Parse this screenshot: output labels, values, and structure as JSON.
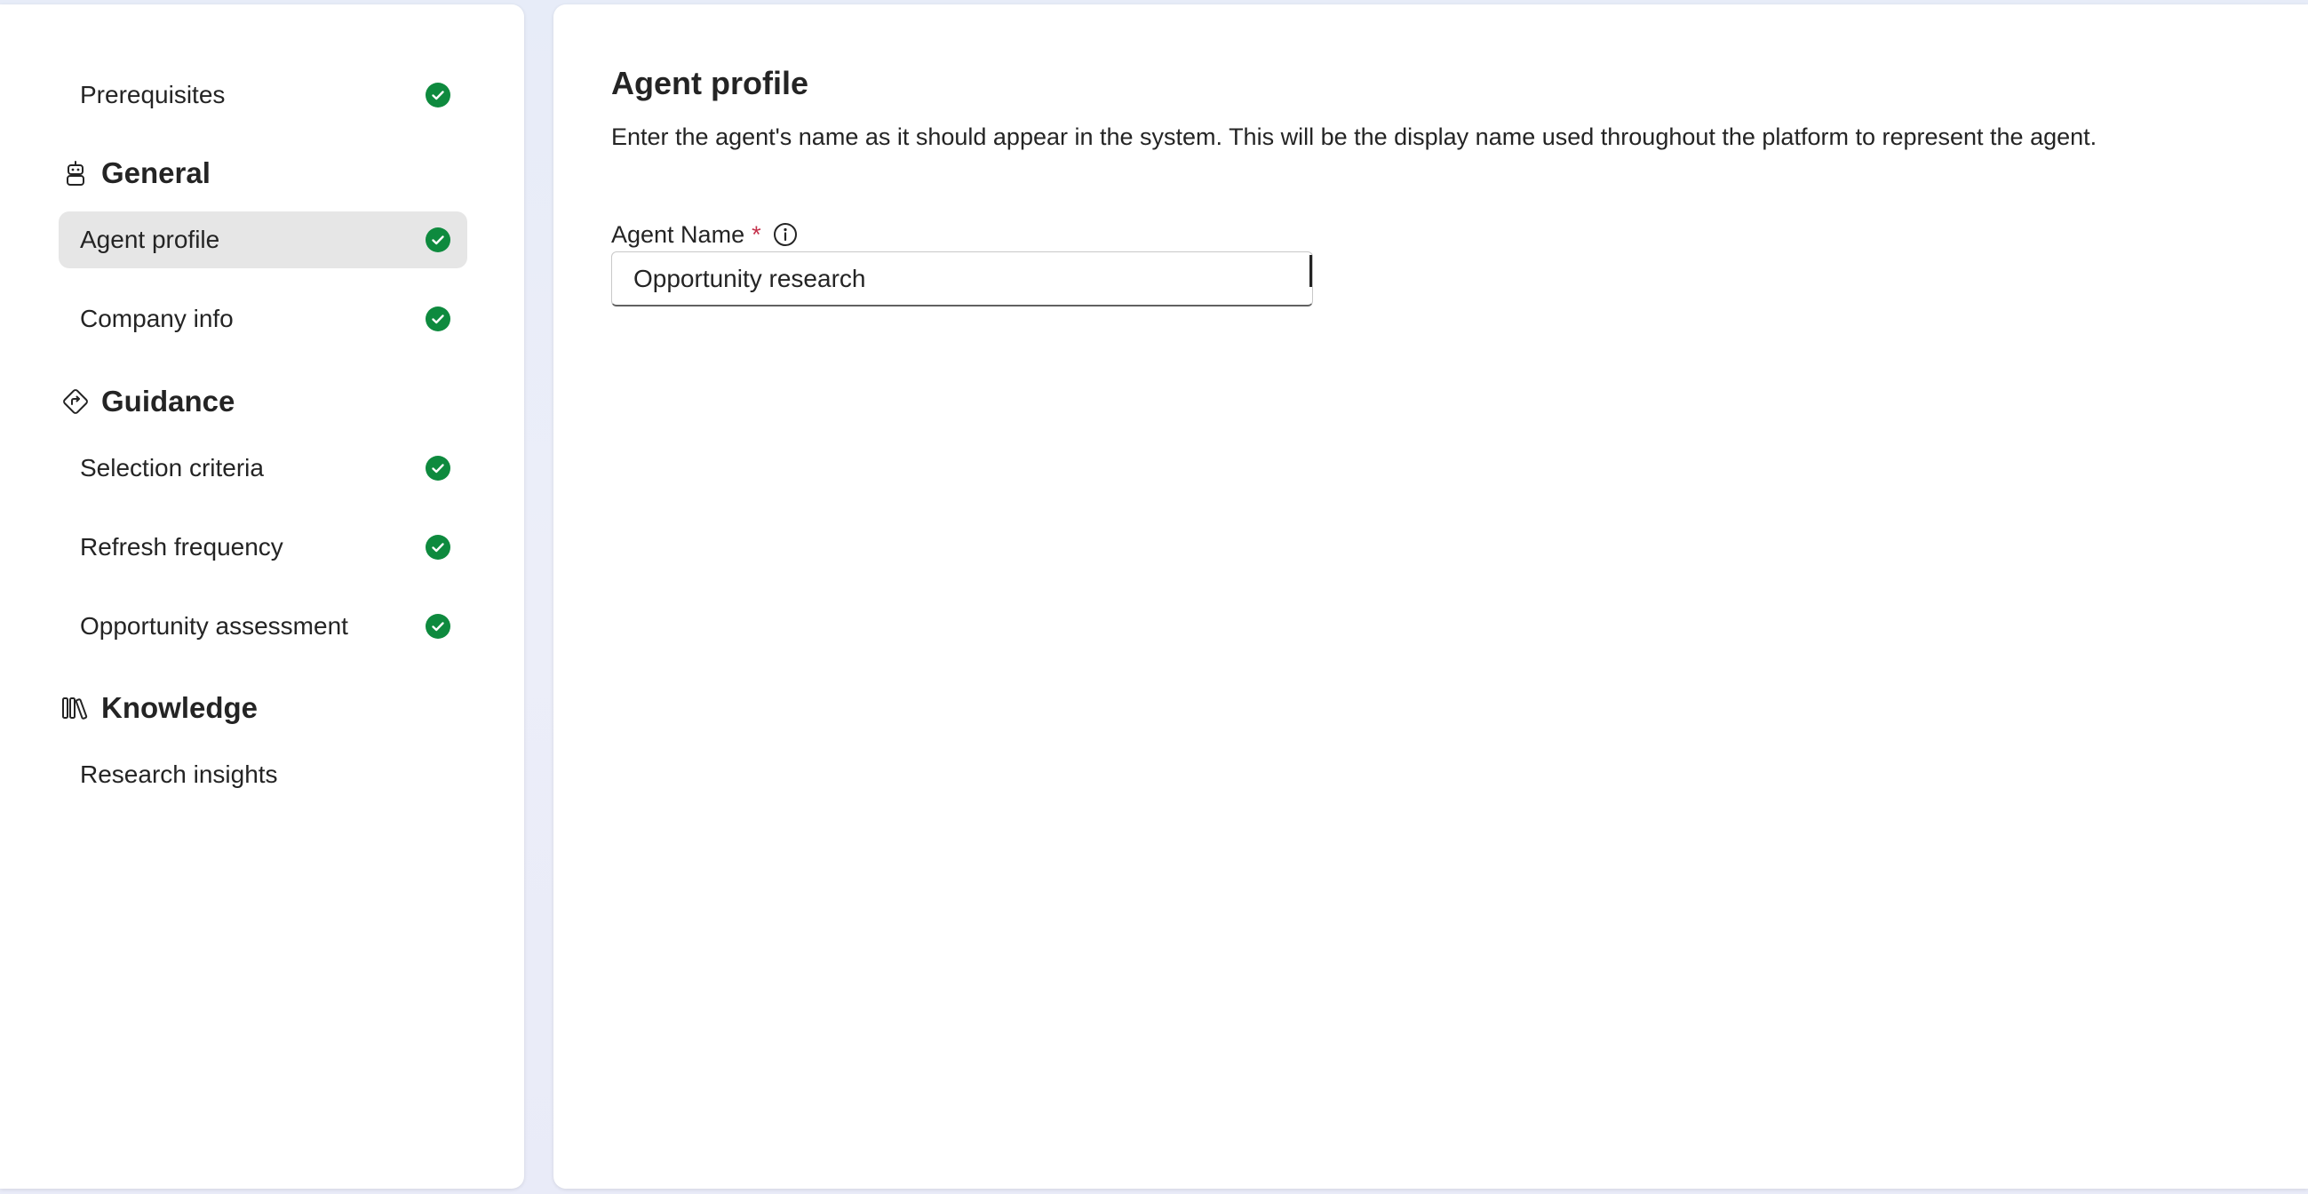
{
  "sidebar": {
    "items": [
      {
        "label": "Prerequisites",
        "status": "complete"
      },
      {
        "section": "General",
        "icon": "bot-icon"
      },
      {
        "label": "Agent profile",
        "status": "complete",
        "selected": true
      },
      {
        "label": "Company info",
        "status": "complete"
      },
      {
        "section": "Guidance",
        "icon": "direction-sign-icon"
      },
      {
        "label": "Selection criteria",
        "status": "complete"
      },
      {
        "label": "Refresh frequency",
        "status": "complete"
      },
      {
        "label": "Opportunity assessment",
        "status": "complete"
      },
      {
        "section": "Knowledge",
        "icon": "library-books-icon"
      },
      {
        "label": "Research insights"
      }
    ]
  },
  "main": {
    "title": "Agent profile",
    "description": "Enter the agent's name as it should appear in the system. This will be the display name used throughout the platform to represent the agent.",
    "field": {
      "label": "Agent Name",
      "required_marker": "*",
      "value": "Opportunity research",
      "info_icon": "info-icon"
    }
  },
  "colors": {
    "check_green": "#0e8a3e",
    "selected_bg": "#e6e6e6",
    "required_red": "#c4314b",
    "page_bg": "#e9ecf8"
  }
}
